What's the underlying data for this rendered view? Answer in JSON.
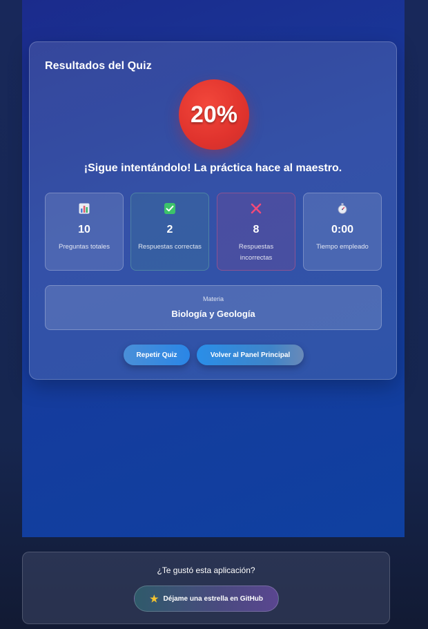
{
  "quiz": {
    "title": "Resultados del Quiz",
    "score": "20%",
    "message": "¡Sigue intentándolo! La práctica hace al maestro.",
    "stats": [
      {
        "icon": "bar-chart-icon",
        "value": "10",
        "label": "Preguntas totales"
      },
      {
        "icon": "check-icon",
        "value": "2",
        "label": "Respuestas correctas"
      },
      {
        "icon": "cross-icon",
        "value": "8",
        "label": "Respuestas incorrectas"
      },
      {
        "icon": "stopwatch-icon",
        "value": "0:00",
        "label": "Tiempo empleado"
      }
    ],
    "subject": {
      "label": "Materia",
      "value": "Biología y Geología"
    },
    "buttons": {
      "retry": "Repetir Quiz",
      "home": "Volver al Panel Principal"
    }
  },
  "footer": {
    "question": "¿Te gustó esta aplicación?",
    "github_label": "Déjame una estrella en GitHub",
    "github_icon": "star-icon"
  },
  "colors": {
    "score_red": "#e0332d",
    "check_green": "#3cc36a",
    "cross_pink": "#f24a7a",
    "button_blue": "#2a86e6",
    "star_gold": "#f4c430"
  }
}
